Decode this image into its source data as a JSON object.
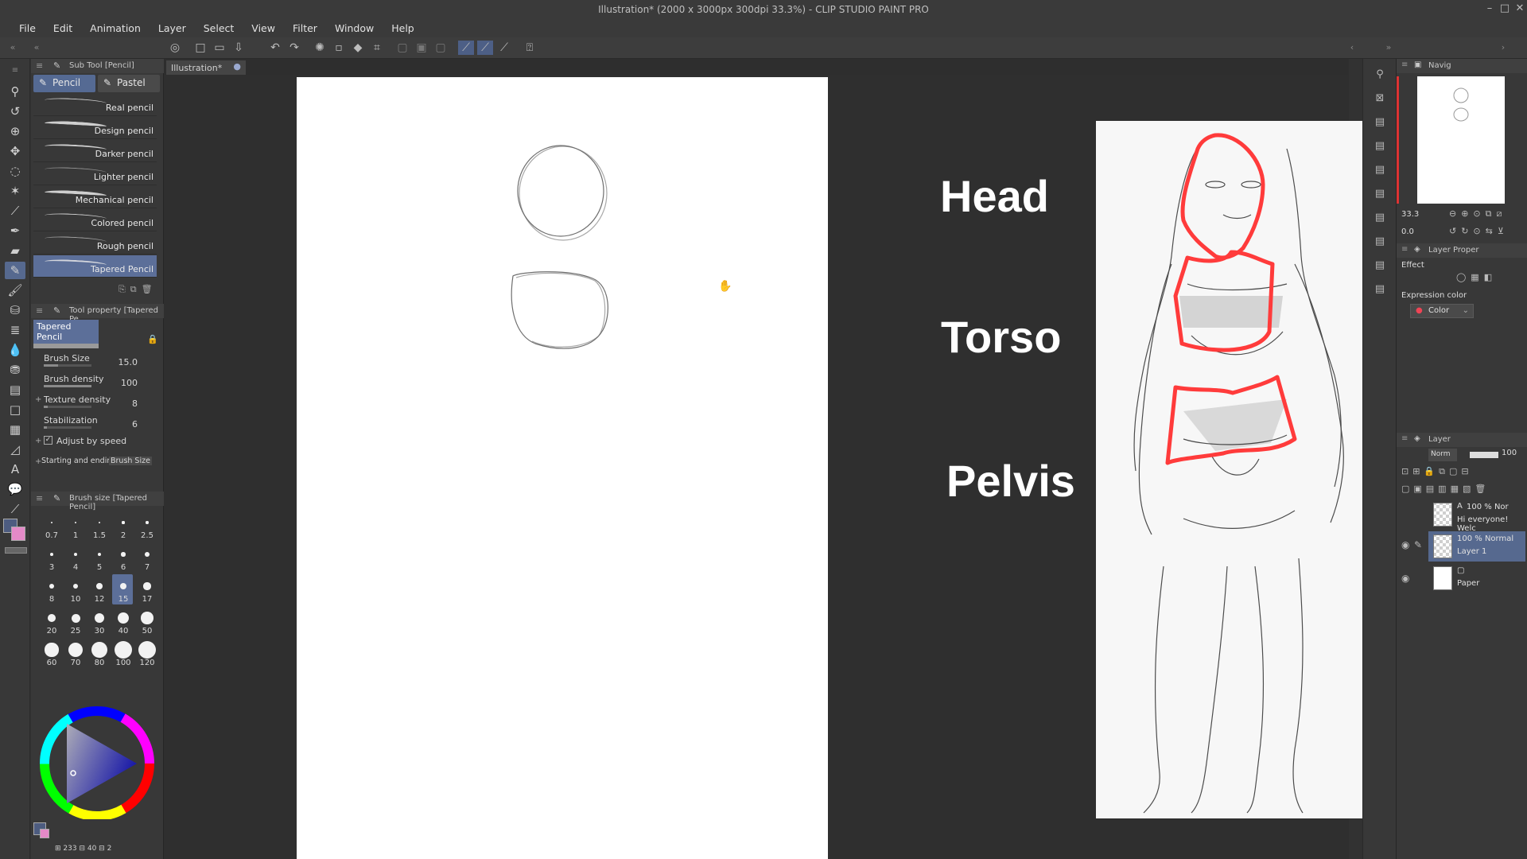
{
  "app": {
    "window_title": "Illustration* (2000 x 3000px 300dpi 33.3%)  - CLIP STUDIO PAINT PRO",
    "window_controls": [
      "–",
      "□",
      "✕"
    ]
  },
  "menus": [
    "File",
    "Edit",
    "Animation",
    "Layer",
    "Select",
    "View",
    "Filter",
    "Window",
    "Help"
  ],
  "sub_tool": {
    "header": "Sub Tool [Pencil]",
    "tabs": [
      "Pencil",
      "Pastel"
    ],
    "brushes": [
      "Real pencil",
      "Design pencil",
      "Darker pencil",
      "Lighter pencil",
      "Mechanical pencil",
      "Colored pencil",
      "Rough pencil",
      "Tapered Pencil"
    ],
    "selected": "Tapered Pencil"
  },
  "tool_property": {
    "header": "Tool property [Tapered Pe",
    "preset_name": "Tapered Pencil",
    "brush_size_label": "Brush Size",
    "brush_size_value": "15.0",
    "brush_density_label": "Brush density",
    "brush_density_value": "100",
    "texture_density_label": "Texture density",
    "texture_density_value": "8",
    "stabilization_label": "Stabilization",
    "stabilization_value": "6",
    "adjust_by_speed_label": "Adjust by speed",
    "adjust_by_speed_checked": true,
    "starting_ending_label": "Starting and ending",
    "starting_ending_value": "Brush Size"
  },
  "brush_size_palette": {
    "header": "Brush size [Tapered Pencil]",
    "sizes": [
      "0.7",
      "1",
      "1.5",
      "2",
      "2.5",
      "3",
      "4",
      "5",
      "6",
      "7",
      "8",
      "10",
      "12",
      "15",
      "17",
      "20",
      "25",
      "30",
      "40",
      "50",
      "60",
      "70",
      "80",
      "100",
      "120"
    ],
    "selected": "15"
  },
  "color_status": {
    "text_left": "233",
    "text_mid": "40",
    "text_right": "2"
  },
  "document": {
    "tab_label": "Illustration*",
    "close_glyph": "●"
  },
  "overlay_labels": {
    "head": "Head",
    "torso": "Torso",
    "pelvis": "Pelvis"
  },
  "navigator": {
    "header": "Navig",
    "zoom": "33.3",
    "rotation": "0.0"
  },
  "layer_property": {
    "header": "Layer Proper",
    "effect_label": "Effect",
    "expression_color_label": "Expression color",
    "expression_color_value": "Color"
  },
  "layers": {
    "header": "Layer",
    "blend_mode": "Norm",
    "opacity": "100",
    "items": [
      {
        "line1": "100 % Nor",
        "line2": "Hi everyone! Welc",
        "type": "text"
      },
      {
        "line1": "100 % Normal",
        "line2": "Layer 1",
        "type": "raster"
      },
      {
        "line1": "",
        "line2": "Paper",
        "type": "paper"
      }
    ]
  },
  "colors": {
    "accent": "#56698f",
    "red_outline": "#ff3b3b",
    "panel_bg": "#383838"
  }
}
